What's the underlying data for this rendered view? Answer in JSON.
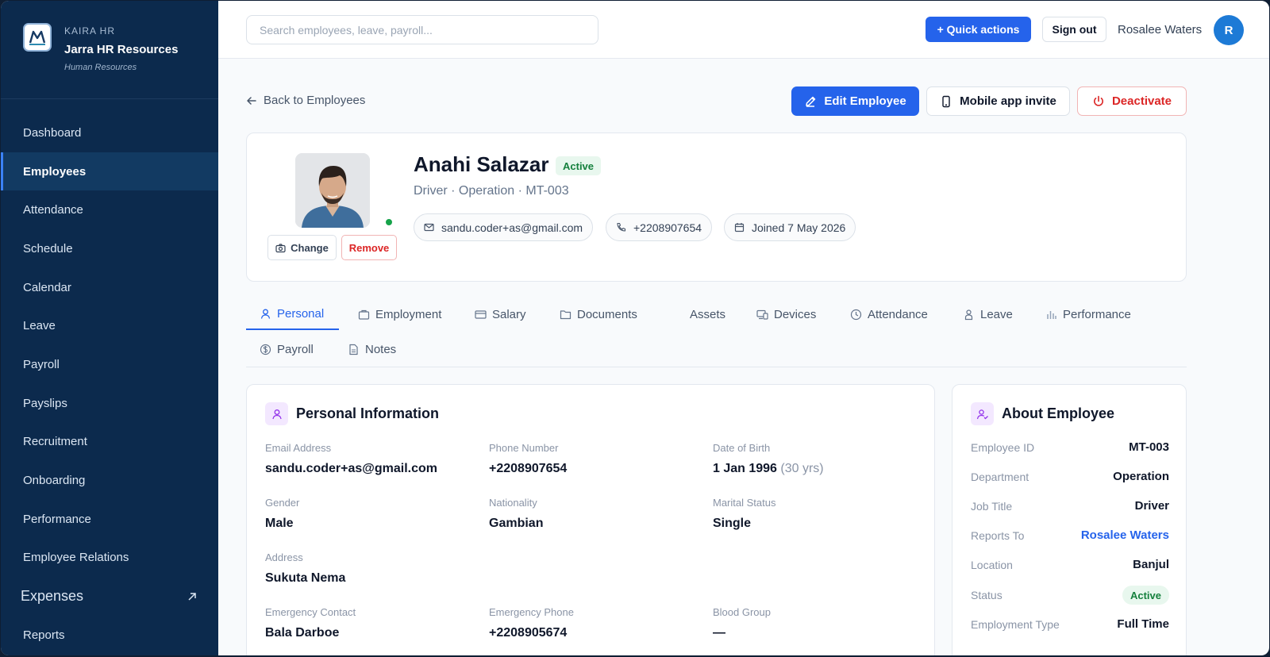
{
  "brand": {
    "small": "KAIRA HR",
    "name": "Jarra HR Resources",
    "sub": "Human Resources"
  },
  "nav": [
    {
      "label": "Dashboard",
      "active": false
    },
    {
      "label": "Employees",
      "active": true
    },
    {
      "label": "Attendance",
      "active": false
    },
    {
      "label": "Schedule",
      "active": false
    },
    {
      "label": "Calendar",
      "active": false
    },
    {
      "label": "Leave",
      "active": false
    },
    {
      "label": "Payroll",
      "active": false
    },
    {
      "label": "Payslips",
      "active": false
    },
    {
      "label": "Recruitment",
      "active": false
    },
    {
      "label": "Onboarding",
      "active": false
    },
    {
      "label": "Performance",
      "active": false
    },
    {
      "label": "Employee Relations",
      "active": false
    },
    {
      "label": "Expenses",
      "active": false,
      "icon": "external-link-icon"
    },
    {
      "label": "Reports",
      "active": false
    }
  ],
  "topbar": {
    "search_placeholder": "Search employees, leave, payroll...",
    "quick_actions": "+ Quick actions",
    "sign_out": "Sign out",
    "user_name": "Rosalee Waters",
    "user_initial": "R"
  },
  "actions": {
    "back": "Back to Employees",
    "edit": "Edit Employee",
    "mobile_invite": "Mobile app invite",
    "deactivate": "Deactivate"
  },
  "profile": {
    "name": "Anahi Salazar",
    "status": "Active",
    "subtitle": "Driver · Operation · MT-003",
    "email": "sandu.coder+as@gmail.com",
    "phone": "+2208907654",
    "joined": "Joined 7 May 2026",
    "change_label": "Change",
    "remove_label": "Remove"
  },
  "tabs": [
    {
      "label": "Personal",
      "icon": "user-icon",
      "active": true
    },
    {
      "label": "Employment",
      "icon": "briefcase-icon",
      "active": false
    },
    {
      "label": "Salary",
      "icon": "credit-card-icon",
      "active": false
    },
    {
      "label": "Documents",
      "icon": "folder-icon",
      "active": false
    },
    {
      "label": "Assets",
      "icon": "",
      "active": false
    },
    {
      "label": "Devices",
      "icon": "devices-icon",
      "active": false
    },
    {
      "label": "Attendance",
      "icon": "clock-icon",
      "active": false
    },
    {
      "label": "Leave",
      "icon": "person-icon",
      "active": false
    },
    {
      "label": "Performance",
      "icon": "bar-chart-icon",
      "active": false
    },
    {
      "label": "Payroll",
      "icon": "dollar-circle-icon",
      "active": false
    },
    {
      "label": "Notes",
      "icon": "file-text-icon",
      "active": false
    }
  ],
  "personal": {
    "title": "Personal Information",
    "fields": [
      {
        "label": "Email Address",
        "value": "sandu.coder+as@gmail.com"
      },
      {
        "label": "Phone Number",
        "value": "+2208907654"
      },
      {
        "label": "Date of Birth",
        "value": "1 Jan 1996",
        "extra": "(30 yrs)"
      },
      {
        "label": "Gender",
        "value": "Male"
      },
      {
        "label": "Nationality",
        "value": "Gambian"
      },
      {
        "label": "Marital Status",
        "value": "Single"
      },
      {
        "label": "Address",
        "value": "Sukuta Nema"
      },
      {
        "label": "Emergency Contact",
        "value": "Bala Darboe"
      },
      {
        "label": "Emergency Phone",
        "value": "+2208905674"
      },
      {
        "label": "Blood Group",
        "value": "—"
      }
    ]
  },
  "about": {
    "title": "About Employee",
    "rows": [
      {
        "label": "Employee ID",
        "value": "MT-003"
      },
      {
        "label": "Department",
        "value": "Operation"
      },
      {
        "label": "Job Title",
        "value": "Driver"
      },
      {
        "label": "Reports To",
        "value": "Rosalee Waters",
        "link": true
      },
      {
        "label": "Location",
        "value": "Banjul"
      },
      {
        "label": "Status",
        "value": "Active",
        "pill": true
      },
      {
        "label": "Employment Type",
        "value": "Full Time"
      }
    ]
  },
  "colors": {
    "sidebar": "#0c2a4d",
    "accent": "#2563eb",
    "danger": "#dc2626",
    "success": "#15803d"
  }
}
